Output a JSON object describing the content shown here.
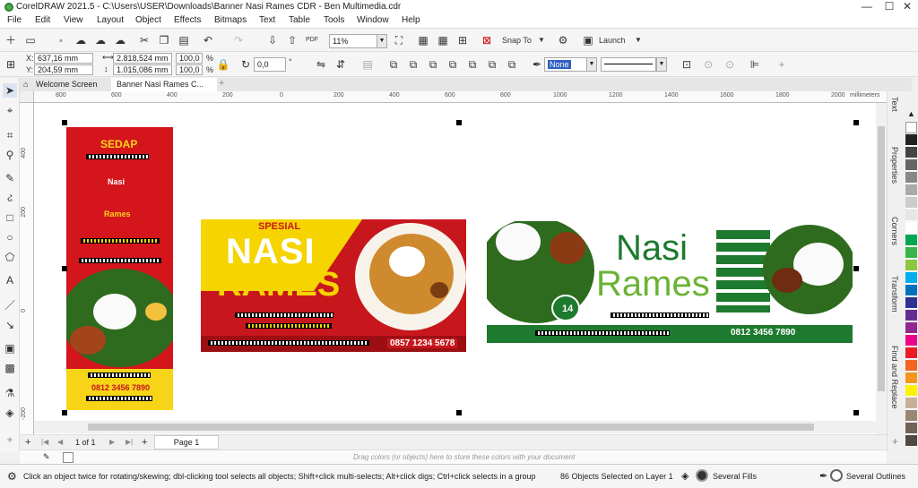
{
  "app": {
    "title": "CorelDRAW 2021.5 - C:\\Users\\USER\\Downloads\\Banner Nasi Rames CDR - Ben Multimedia.cdr",
    "window_controls": [
      "—",
      "☐",
      "✕"
    ]
  },
  "menu": [
    "File",
    "Edit",
    "View",
    "Layout",
    "Object",
    "Effects",
    "Bitmaps",
    "Text",
    "Table",
    "Tools",
    "Window",
    "Help"
  ],
  "toolbar": {
    "zoom": "11%",
    "snap_to": "Snap To",
    "launch": "Launch"
  },
  "property_bar": {
    "x": "637,16 mm",
    "y": "204,59 mm",
    "width": "2.818,524 mm",
    "height": "1.015,086 mm",
    "scale_w": "100,0",
    "scale_h": "100,0",
    "percent": "%",
    "rotation": "0,0",
    "degree": "°",
    "outline_width": "None",
    "x_label": "X:",
    "y_label": "Y:"
  },
  "tabs": [
    {
      "label": "Welcome Screen",
      "active": false
    },
    {
      "label": "Banner Nasi Rames C...",
      "active": true
    }
  ],
  "ruler": {
    "h_ticks": [
      "800",
      "600",
      "400",
      "200",
      "0",
      "200",
      "400",
      "600",
      "800",
      "1000",
      "1200",
      "1400",
      "1600",
      "1800",
      "2000"
    ],
    "unit": "millimeters",
    "v_ticks": [
      "400",
      "200",
      "0",
      "-200"
    ]
  },
  "dockers": [
    "Text",
    "Properties",
    "Corners",
    "Transform",
    "Find and Replace"
  ],
  "palette": [
    "#222222",
    "#444444",
    "#666666",
    "#888888",
    "#aaaaaa",
    "#cccccc",
    "#e6e6e6",
    "#ffffff",
    "#00a651",
    "#39b54a",
    "#8dc63f",
    "#00aeef",
    "#0072bc",
    "#2e3192",
    "#662d91",
    "#92278f",
    "#ec008c",
    "#ed1c24",
    "#f26522",
    "#f7941d",
    "#fff200",
    "#c7b299",
    "#998675",
    "#736357",
    "#534741"
  ],
  "page_nav": {
    "page_count": "1 of 1",
    "page_tab": "Page 1"
  },
  "color_bar": {
    "hint": "Drag colors (or objects) here to store these colors with your document"
  },
  "status": {
    "hint": "Click an object twice for rotating/skewing; dbl-clicking tool selects all objects; Shift+click multi-selects; Alt+click digs; Ctrl+click selects in a group",
    "selection": "86 Objects Selected on Layer 1",
    "fill": "Several Fills",
    "outline": "Several Outlines"
  },
  "artwork": {
    "vertical": {
      "title": "SEDAP",
      "line1": "Nasi",
      "line2": "Rames",
      "phone": "0812 3456 7890",
      "bg": "#d4151c",
      "accent": "#f7d417"
    },
    "horizontal_red": {
      "tag": "SPESIAL",
      "word1": "NASI",
      "word2": "RAMES",
      "phone": "0857 1234 5678",
      "bg": "#c8161d",
      "accent": "#f5d400"
    },
    "horizontal_green": {
      "word1": "Nasi",
      "word2": "Rames",
      "badge": "14",
      "phone": "0812 3456 7890",
      "green": "#1e7a2e",
      "light_green": "#6ab335"
    }
  }
}
